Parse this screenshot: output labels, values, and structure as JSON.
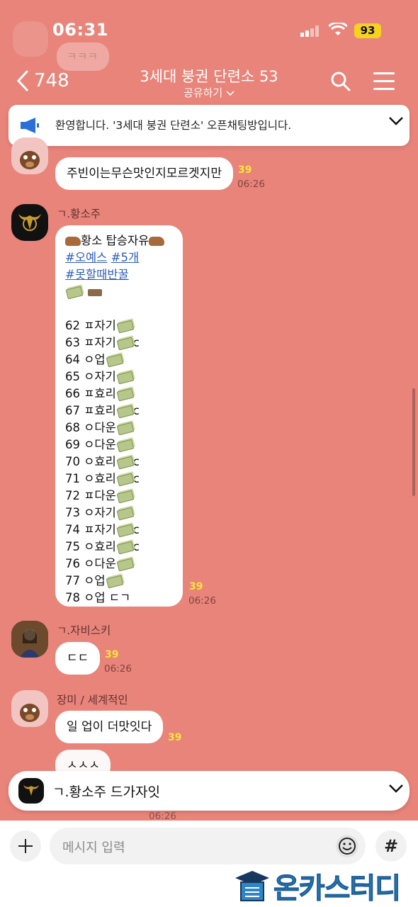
{
  "status_bar": {
    "time": "06:31",
    "battery": "93"
  },
  "background_snippet": {
    "text": "ㅋㅋㅋ"
  },
  "header": {
    "back_count": "748",
    "title": "3세대 붕권 단련소 53",
    "subtitle": "공유하기"
  },
  "notice": {
    "text": "환영합니다. '3세대 붕권 단련소' 오픈채팅방입니다."
  },
  "messages": [
    {
      "sender": "장미 / 세계적인",
      "text": "주빈이는무슨맛인지모르겟지만",
      "unread": "39",
      "time": "06:26"
    },
    {
      "sender": "ㄱ.황소주",
      "header_line": "황소 탑승자유",
      "tags_line1": [
        "#오예스",
        "#5개"
      ],
      "tags_line2": "#못할때반꿀",
      "items": [
        {
          "num": "62",
          "text": "ㅍ자기",
          "suffix": ""
        },
        {
          "num": "63",
          "text": "ㅍ자기",
          "suffix": "c"
        },
        {
          "num": "64",
          "text": "ㅇ업",
          "suffix": ""
        },
        {
          "num": "65",
          "text": "ㅇ자기",
          "suffix": ""
        },
        {
          "num": "66",
          "text": "ㅍ효리",
          "suffix": ""
        },
        {
          "num": "67",
          "text": "ㅍ효리",
          "suffix": "c"
        },
        {
          "num": "68",
          "text": "ㅇ다운",
          "suffix": ""
        },
        {
          "num": "69",
          "text": "ㅇ다운",
          "suffix": ""
        },
        {
          "num": "70",
          "text": "ㅇ효리",
          "suffix": "c"
        },
        {
          "num": "71",
          "text": "ㅇ효리",
          "suffix": "c"
        },
        {
          "num": "72",
          "text": "ㅍ다운",
          "suffix": ""
        },
        {
          "num": "73",
          "text": "ㅇ자기",
          "suffix": ""
        },
        {
          "num": "74",
          "text": "ㅍ자기",
          "suffix": "c"
        },
        {
          "num": "75",
          "text": "ㅇ효리",
          "suffix": "c"
        },
        {
          "num": "76",
          "text": "ㅇ다운",
          "suffix": ""
        },
        {
          "num": "77",
          "text": "ㅇ업",
          "suffix": ""
        }
      ],
      "last_line": "78 ㅇ업 ㄷㄱ",
      "unread": "39",
      "time": "06:26"
    },
    {
      "sender": "ㄱ.자비스키",
      "text": "ㄷㄷ",
      "unread": "39",
      "time": "06:26"
    },
    {
      "sender": "장미 / 세계적인",
      "text": "일 업이 더맛잇다",
      "unread": "39",
      "text2": "ㅅㅅㅅ",
      "time": "06:26"
    }
  ],
  "pinned": {
    "text": "ㄱ.황소주 드가자잇"
  },
  "input": {
    "placeholder": "메시지 입력"
  },
  "watermark": {
    "text": "온카스터디"
  },
  "colors": {
    "background": "#e8847a",
    "unread": "#f8e43a",
    "battery": "#f4d21f",
    "tag": "#2f5fb7",
    "watermark": "#2e86c6"
  }
}
